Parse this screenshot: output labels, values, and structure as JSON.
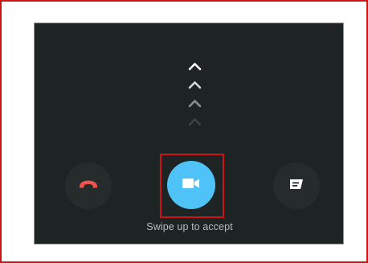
{
  "call_screen": {
    "swipe_hint": "Swipe up to accept",
    "decline_icon": "phone-hangup-icon",
    "accept_icon": "video-camera-icon",
    "message_icon": "message-icon",
    "colors": {
      "background": "#1e2424",
      "accent": "#4fc3f7",
      "decline": "#ef5350",
      "button_bg": "#262c2c",
      "highlight_border": "#d01414"
    }
  }
}
